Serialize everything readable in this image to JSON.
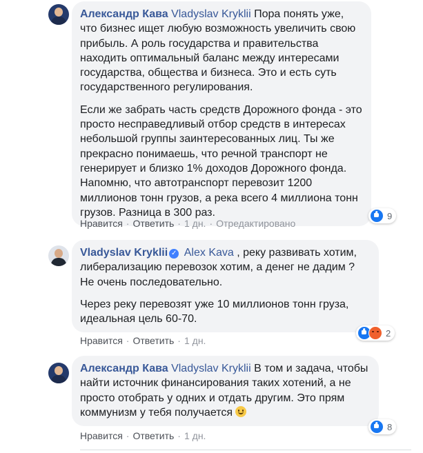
{
  "comments": [
    {
      "author": "Александр Кава",
      "mention": "Vladyslav Kryklii",
      "paragraphs": [
        " Пора понять уже, что бизнес ищет любую возможность увеличить свою прибыль. А роль государства и правительства находить оптимальный баланс между интересами государства, общества и бизнеса. Это и есть суть государственного регулирования.",
        "Если же забрать часть средств Дорожного фонда - это просто несправедливый отбор средств в интересах небольшой группы заинтересованных лиц. Ты же прекрасно понимаешь, что речной транспорт не генерирует и близко 1% доходов Дорожного фонда. Напомню, что автотранспорт перевозит 1200 миллионов тонн грузов, а река всего 4 миллиона тонн грузов. Разница в 300 раз."
      ],
      "actions": {
        "like": "Нравится",
        "reply": "Ответить",
        "time": "1 дн.",
        "edited": "Отредактировано"
      },
      "reactions": {
        "types": [
          "like"
        ],
        "count": "9"
      }
    },
    {
      "author": "Vladyslav Kryklii",
      "verified": true,
      "mention": "Alex Kava",
      "paragraphs": [
        " , реку развивать хотим, либерализацию перевозок хотим, а денег не дадим ? Не очень последовательно.",
        "Через реку перевозят уже 10 миллионов тонн груза, идеальная цель 60-70."
      ],
      "actions": {
        "like": "Нравится",
        "reply": "Ответить",
        "time": "1 дн."
      },
      "reactions": {
        "types": [
          "like",
          "angry"
        ],
        "count": "2"
      }
    },
    {
      "author": "Александр Кава",
      "mention": "Vladyslav Kryklii",
      "paragraphs": [
        " В том и задача, чтобы найти источник финансирования таких хотений, а не просто отобрать у одних и отдать другим. Это прям коммунизм у тебя получается "
      ],
      "emoji": "smiley",
      "actions": {
        "like": "Нравится",
        "reply": "Ответить",
        "time": "1 дн."
      },
      "reactions": {
        "types": [
          "like"
        ],
        "count": "8"
      }
    }
  ],
  "separator": "·"
}
